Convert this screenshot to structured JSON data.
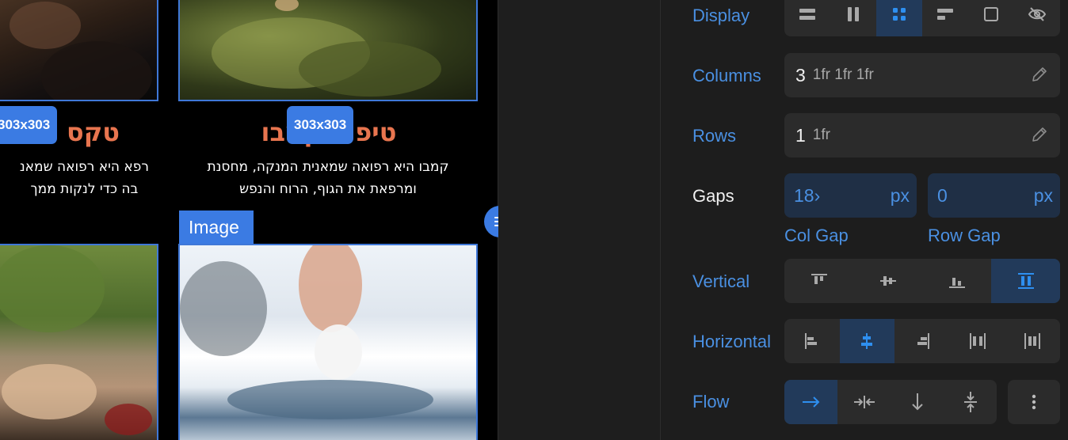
{
  "canvas": {
    "item_left": {
      "title": "טקס",
      "dimension": "303x303",
      "line1": "רפא היא רפואה שמאנ",
      "line2": "בה כדי לנקות ממך"
    },
    "item_right": {
      "title": "טיפול קמבו",
      "dimension": "303x303",
      "line1": "קמבו היא רפואה שמאנית המנקה, מחסנת",
      "line2": "ומרפאת את הגוף, הרוח והנפש"
    },
    "image_tag": "Image"
  },
  "panel": {
    "display": {
      "label": "Display",
      "options": [
        "block",
        "flex",
        "grid",
        "inline",
        "inline-block",
        "none"
      ],
      "active": "grid"
    },
    "columns": {
      "label": "Columns",
      "count": "3",
      "template": "1fr 1fr 1fr"
    },
    "rows": {
      "label": "Rows",
      "count": "1",
      "template": "1fr"
    },
    "gaps": {
      "label": "Gaps",
      "col_value": "18›",
      "col_unit": "px",
      "col_label": "Col Gap",
      "row_value": "0",
      "row_unit": "px",
      "row_label": "Row Gap"
    },
    "vertical": {
      "label": "Vertical",
      "options": [
        "start",
        "center",
        "end",
        "stretch"
      ],
      "active": "stretch"
    },
    "horizontal": {
      "label": "Horizontal",
      "options": [
        "start",
        "center",
        "end",
        "space-between",
        "space-around"
      ],
      "active": "center"
    },
    "flow": {
      "label": "Flow",
      "options": [
        "row",
        "column-dense",
        "column",
        "row-dense"
      ],
      "active": "row"
    }
  },
  "colors": {
    "accent": "#4a90e2",
    "selection": "#3b7be3",
    "title": "#e8754f"
  }
}
